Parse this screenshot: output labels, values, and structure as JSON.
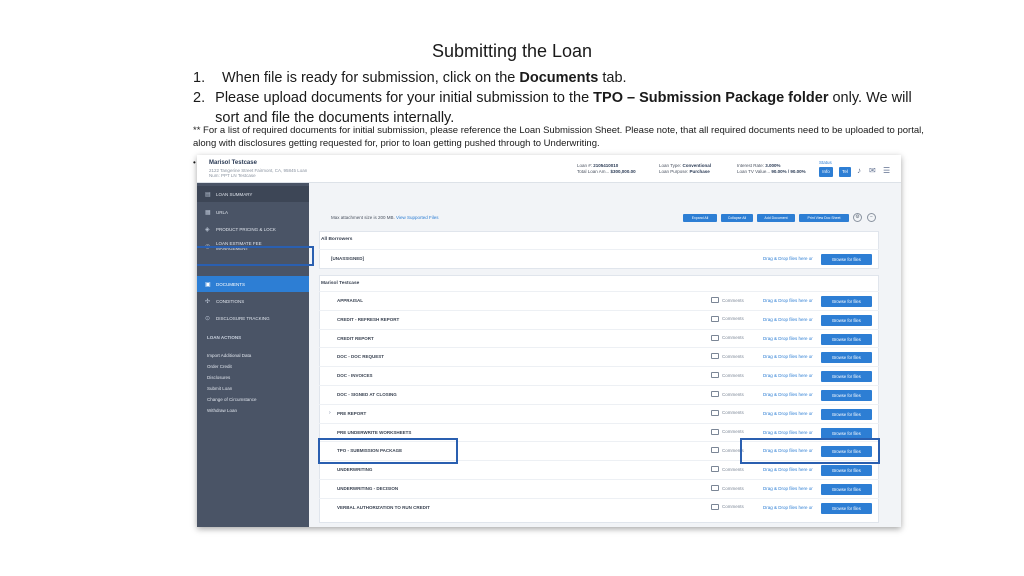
{
  "slide": {
    "title": "Submitting the Loan",
    "steps": [
      {
        "num": "1.",
        "pre": "When file is ready for submission, click on the ",
        "bold": "Documents",
        "post": " tab."
      },
      {
        "num": "2.",
        "pre": "Please upload documents for your initial submission to the ",
        "bold": "TPO – Submission Package folder",
        "post": " only. We will sort and file the documents internally."
      }
    ],
    "note": "** For a list of required documents for initial submission, please reference the Loan Submission Sheet. Please note, that all required documents need to be uploaded to portal, along with disclosures getting requested for, prior to loan getting pushed through to Underwriting.",
    "bullet": "•"
  },
  "app": {
    "borrower_name": "Marisol Testcase",
    "borrower_address": "2122 Tangerine Street Fairmont, CA, 95845 Loan Num: PPT LN Testcase",
    "header_fields": [
      {
        "label": "Loan #:",
        "value": "2105410010"
      },
      {
        "label": "Total Loan Am...",
        "value": "$300,000.00"
      },
      {
        "label": "Loan Type:",
        "value": "Conventional"
      },
      {
        "label": "Loan Purpose:",
        "value": "Purchase"
      },
      {
        "label": "Interest Rate:",
        "value": "3.000%"
      },
      {
        "label": "Loan TV Value...",
        "value": "90.00% / 90.00%"
      }
    ],
    "header_status_label": "Status",
    "header_btn1": "Info",
    "header_btn2": "Tel",
    "sidebar": {
      "items": [
        {
          "label": "LOAN SUMMARY",
          "icon": "summary-icon"
        },
        {
          "label": "URLA",
          "icon": "form-icon"
        },
        {
          "label": "PRODUCT PRICING & LOCK",
          "icon": "pricing-icon"
        },
        {
          "label": "LOAN ESTIMATE FEE MANAGEMENT",
          "icon": "fee-icon"
        },
        {
          "label": "DOCUMENTS",
          "icon": "documents-icon"
        },
        {
          "label": "CONDITIONS",
          "icon": "conditions-icon"
        },
        {
          "label": "DISCLOSURE TRACKING",
          "icon": "tracking-icon"
        }
      ],
      "actions_heading": "LOAN ACTIONS",
      "actions": [
        "Import Additional Data",
        "Order Credit",
        "Disclosures",
        "Submit Loan",
        "Change of Circumstance",
        "Withdraw Loan"
      ]
    },
    "toolbar": {
      "max_text": "Max attachment size is 200 MB.",
      "view_link": "View Supported Files",
      "buttons": [
        "Expand All",
        "Collapse All",
        "Add Document",
        "Print View Doc Sheet"
      ]
    },
    "all_borrowers_heading": "All Borrowers",
    "unassigned_row": {
      "label": "[UNASSIGNED]",
      "drag": "Drag & Drop files here or",
      "browse": "Browse for files"
    },
    "borrower_heading": "Marisol Testcase",
    "comments_label": "Comments",
    "drag_label": "Drag & Drop files here or",
    "browse_label": "Browse for files",
    "doc_rows": [
      "APPRAISAL",
      "CREDIT - REFRESH REPORT",
      "CREDIT REPORT",
      "DOC - DOC REQUEST",
      "DOC - INVOICES",
      "DOC - SIGNED AT CLOSING",
      "PRE REPORT",
      "PRE UNDERWRITE WORKSHEETS",
      "TPO - SUBMISSION PACKAGE",
      "UNDERWRITING",
      "UNDERWRITING - DECISION",
      "VERBAL AUTHORIZATION TO RUN CREDIT"
    ]
  },
  "colors": {
    "accent": "#2d7ed4",
    "sidebar": "#4a5466",
    "highlight": "#2a5fb0"
  }
}
